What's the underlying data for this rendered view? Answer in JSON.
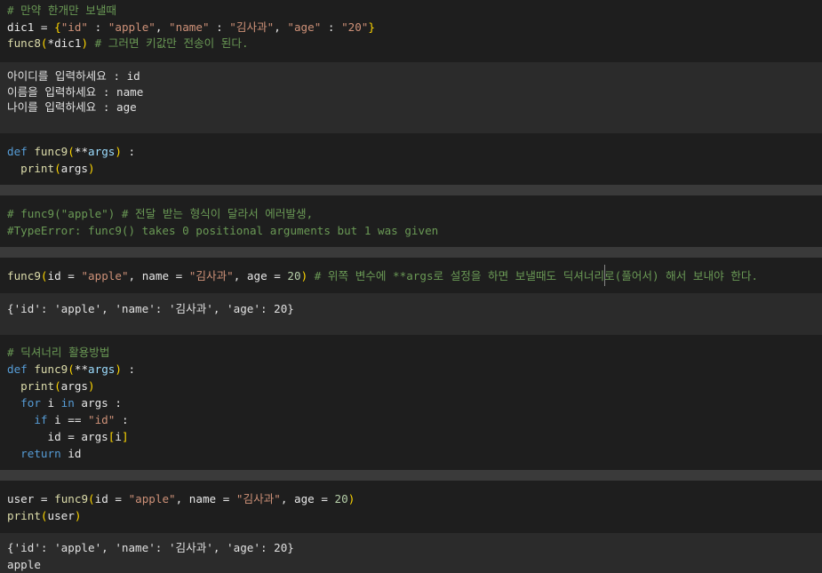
{
  "cells": [
    {
      "kind": "code",
      "lines": [
        [
          {
            "t": "# 만약 한개만 보낼때",
            "c": "c"
          }
        ],
        [
          {
            "t": "dic1 ",
            "c": "w"
          },
          {
            "t": "=",
            "c": "w"
          },
          {
            "t": " {",
            "c": "p"
          },
          {
            "t": "\"id\"",
            "c": "s"
          },
          {
            "t": " : ",
            "c": "w"
          },
          {
            "t": "\"apple\"",
            "c": "s"
          },
          {
            "t": ", ",
            "c": "w"
          },
          {
            "t": "\"name\"",
            "c": "s"
          },
          {
            "t": " : ",
            "c": "w"
          },
          {
            "t": "\"김사과\"",
            "c": "s"
          },
          {
            "t": ", ",
            "c": "w"
          },
          {
            "t": "\"age\"",
            "c": "s"
          },
          {
            "t": " : ",
            "c": "w"
          },
          {
            "t": "\"20\"",
            "c": "s"
          },
          {
            "t": "}",
            "c": "p"
          }
        ],
        [
          {
            "t": "func8",
            "c": "f"
          },
          {
            "t": "(",
            "c": "p"
          },
          {
            "t": "*dic1",
            "c": "w"
          },
          {
            "t": ")",
            "c": "p"
          },
          {
            "t": " # 그러면 키값만 전송이 된다.",
            "c": "c"
          }
        ]
      ]
    },
    {
      "kind": "out",
      "lines": [
        [
          {
            "t": "아이디를 입력하세요 : id",
            "c": "ob"
          }
        ],
        [
          {
            "t": "이름을 입력하세요 : name",
            "c": "ob"
          }
        ],
        [
          {
            "t": "나이를 입력하세요 : age",
            "c": "ob"
          }
        ]
      ]
    },
    {
      "kind": "code",
      "lines": [
        [
          {
            "t": "def ",
            "c": "k"
          },
          {
            "t": "func9",
            "c": "f"
          },
          {
            "t": "(",
            "c": "p"
          },
          {
            "t": "**",
            "c": "w"
          },
          {
            "t": "args",
            "c": "v"
          },
          {
            "t": ")",
            "c": "p"
          },
          {
            "t": " :",
            "c": "w"
          }
        ],
        [
          {
            "t": "  print",
            "c": "f"
          },
          {
            "t": "(",
            "c": "p"
          },
          {
            "t": "args",
            "c": "w"
          },
          {
            "t": ")",
            "c": "p"
          }
        ]
      ]
    },
    {
      "kind": "code",
      "lines": [
        [
          {
            "t": "# func9(\"apple\") # 전달 받는 형식이 달라서 에러발생,",
            "c": "c"
          }
        ],
        [
          {
            "t": "#TypeError: func9() takes 0 positional arguments but 1 was given",
            "c": "c"
          }
        ]
      ]
    },
    {
      "kind": "code",
      "lines": [
        [
          {
            "t": "func9",
            "c": "f"
          },
          {
            "t": "(",
            "c": "p"
          },
          {
            "t": "id ",
            "c": "w"
          },
          {
            "t": "=",
            "c": "w"
          },
          {
            "t": " ",
            "c": "w"
          },
          {
            "t": "\"apple\"",
            "c": "s"
          },
          {
            "t": ", name ",
            "c": "w"
          },
          {
            "t": "=",
            "c": "w"
          },
          {
            "t": " ",
            "c": "w"
          },
          {
            "t": "\"김사과\"",
            "c": "s"
          },
          {
            "t": ", age ",
            "c": "w"
          },
          {
            "t": "=",
            "c": "w"
          },
          {
            "t": " ",
            "c": "w"
          },
          {
            "t": "20",
            "c": "n"
          },
          {
            "t": ")",
            "c": "p"
          },
          {
            "t": " # 위쪽 변수에 **args로 설정을 하면 보낼때도 딕셔너리로(풀어서) 해서 보내야 한다.",
            "c": "c"
          }
        ]
      ]
    },
    {
      "kind": "out",
      "lines": [
        [
          {
            "t": "{'id': 'apple', 'name': '김사과', 'age': 20}",
            "c": "ob"
          }
        ]
      ]
    },
    {
      "kind": "code",
      "lines": [
        [
          {
            "t": "# 딕셔너리 활용방법",
            "c": "c"
          }
        ],
        [
          {
            "t": "def ",
            "c": "k"
          },
          {
            "t": "func9",
            "c": "f"
          },
          {
            "t": "(",
            "c": "p"
          },
          {
            "t": "**",
            "c": "w"
          },
          {
            "t": "args",
            "c": "v"
          },
          {
            "t": ")",
            "c": "p"
          },
          {
            "t": " :",
            "c": "w"
          }
        ],
        [
          {
            "t": "  print",
            "c": "f"
          },
          {
            "t": "(",
            "c": "p"
          },
          {
            "t": "args",
            "c": "w"
          },
          {
            "t": ")",
            "c": "p"
          }
        ],
        [
          {
            "t": "  for ",
            "c": "k"
          },
          {
            "t": "i ",
            "c": "w"
          },
          {
            "t": "in ",
            "c": "k"
          },
          {
            "t": "args :",
            "c": "w"
          }
        ],
        [
          {
            "t": "    if ",
            "c": "k"
          },
          {
            "t": "i ",
            "c": "w"
          },
          {
            "t": "==",
            "c": "w"
          },
          {
            "t": " ",
            "c": "w"
          },
          {
            "t": "\"id\"",
            "c": "s"
          },
          {
            "t": " :",
            "c": "w"
          }
        ],
        [
          {
            "t": "      id ",
            "c": "w"
          },
          {
            "t": "=",
            "c": "w"
          },
          {
            "t": " args",
            "c": "w"
          },
          {
            "t": "[",
            "c": "p"
          },
          {
            "t": "i",
            "c": "w"
          },
          {
            "t": "]",
            "c": "p"
          }
        ],
        [
          {
            "t": "  return ",
            "c": "k"
          },
          {
            "t": "id",
            "c": "w"
          }
        ]
      ]
    },
    {
      "kind": "code",
      "lines": [
        [
          {
            "t": "user ",
            "c": "w"
          },
          {
            "t": "=",
            "c": "w"
          },
          {
            "t": " ",
            "c": "w"
          },
          {
            "t": "func9",
            "c": "f"
          },
          {
            "t": "(",
            "c": "p"
          },
          {
            "t": "id ",
            "c": "w"
          },
          {
            "t": "=",
            "c": "w"
          },
          {
            "t": " ",
            "c": "w"
          },
          {
            "t": "\"apple\"",
            "c": "s"
          },
          {
            "t": ", name ",
            "c": "w"
          },
          {
            "t": "=",
            "c": "w"
          },
          {
            "t": " ",
            "c": "w"
          },
          {
            "t": "\"김사과\"",
            "c": "s"
          },
          {
            "t": ", age ",
            "c": "w"
          },
          {
            "t": "=",
            "c": "w"
          },
          {
            "t": " ",
            "c": "w"
          },
          {
            "t": "20",
            "c": "n"
          },
          {
            "t": ")",
            "c": "p"
          }
        ],
        [
          {
            "t": "print",
            "c": "f"
          },
          {
            "t": "(",
            "c": "p"
          },
          {
            "t": "user",
            "c": "w"
          },
          {
            "t": ")",
            "c": "p"
          }
        ]
      ]
    },
    {
      "kind": "out",
      "lines": [
        [
          {
            "t": "{'id': 'apple', 'name': '김사과', 'age': 20}",
            "c": "ob"
          }
        ],
        [
          {
            "t": "apple",
            "c": "ob"
          }
        ]
      ]
    }
  ]
}
